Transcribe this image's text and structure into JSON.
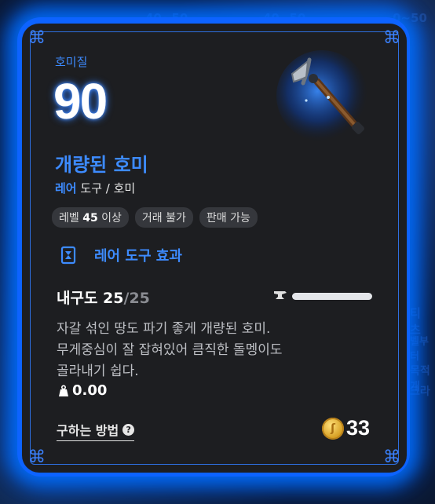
{
  "item": {
    "category": "호미질",
    "level_value": "90",
    "name": "개량된 호미",
    "rarity": "레어",
    "type_path": "도구 / 호미",
    "tags": [
      {
        "prefix": "레벨 ",
        "bold": "45",
        "suffix": " 이상"
      },
      {
        "prefix": "거래 불가",
        "bold": "",
        "suffix": ""
      },
      {
        "prefix": "판매 가능",
        "bold": "",
        "suffix": ""
      }
    ],
    "effect_label": "레어 도구 효과",
    "durability_label": "내구도 25",
    "durability_max": "/25",
    "durability_fraction": 1.0,
    "description": [
      "자갈 섞인 땅도 파기 좋게 개량된 호미.",
      "무게중심이 잘 잡혀있어 큼직한 돌멩이도",
      "골라내기 쉽다."
    ],
    "weight": "0.00",
    "how_to_obtain": "구하는 방법",
    "price": "33"
  },
  "background_fragments": [
    "40~50",
    "40~50",
    "0~50",
    "티 츠",
    "벨부터",
    "목적 개",
    "크라"
  ],
  "colors": {
    "accent": "#3d8bff",
    "glow": "#0d63ff",
    "card": "#1d1e21"
  },
  "icons": [
    "hoe-icon",
    "effect-icon",
    "anvil-icon",
    "weight-icon",
    "help-icon",
    "coin-icon"
  ]
}
